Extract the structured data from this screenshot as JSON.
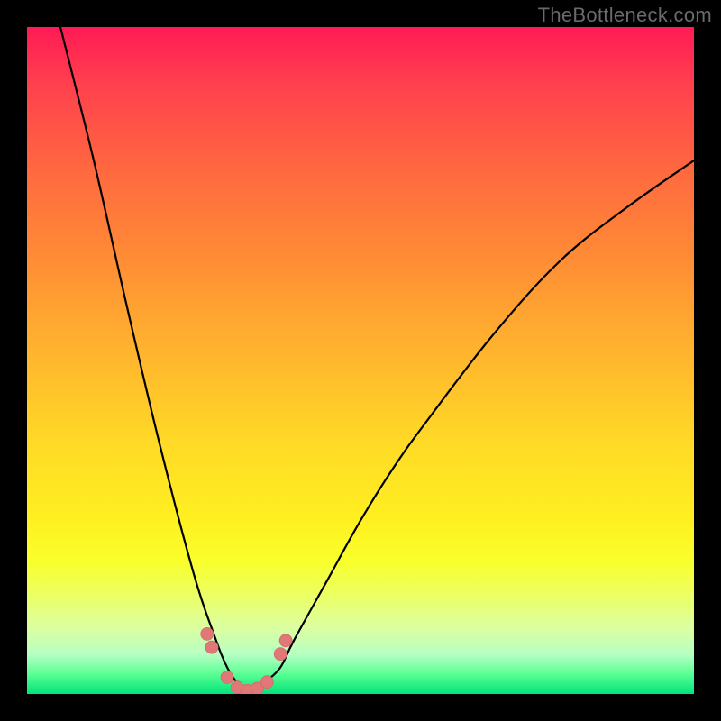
{
  "watermark": "TheBottleneck.com",
  "colors": {
    "background": "#000000",
    "gradient_top": "#ff1a55",
    "gradient_bottom": "#00e47a",
    "curve_stroke": "#000000",
    "dot_fill": "#e07878"
  },
  "chart_data": {
    "type": "line",
    "title": "",
    "xlabel": "",
    "ylabel": "",
    "xlim": [
      0,
      100
    ],
    "ylim": [
      0,
      100
    ],
    "grid": false,
    "series": [
      {
        "name": "bottleneck-curve",
        "description": "V-shaped curve; minimum near x≈33, y≈0. Color gradient encodes y: green≈0 (good), red≈100 (bad).",
        "x": [
          5,
          10,
          15,
          20,
          25,
          28,
          30,
          32,
          33,
          34,
          35,
          36,
          38,
          40,
          45,
          50,
          55,
          60,
          70,
          80,
          90,
          100
        ],
        "y": [
          100,
          80,
          58,
          37,
          18,
          9,
          4,
          1,
          0,
          0,
          1,
          2,
          4,
          8,
          17,
          26,
          34,
          41,
          54,
          65,
          73,
          80
        ]
      }
    ],
    "markers": {
      "description": "Salmon dots clustered around the trough of the curve",
      "points": [
        {
          "x": 27,
          "y": 9
        },
        {
          "x": 27.7,
          "y": 7
        },
        {
          "x": 30,
          "y": 2.5
        },
        {
          "x": 31.5,
          "y": 1
        },
        {
          "x": 33,
          "y": 0.5
        },
        {
          "x": 34.5,
          "y": 0.8
        },
        {
          "x": 36,
          "y": 1.8
        },
        {
          "x": 38,
          "y": 6
        },
        {
          "x": 38.8,
          "y": 8
        }
      ],
      "radius": 7
    }
  }
}
